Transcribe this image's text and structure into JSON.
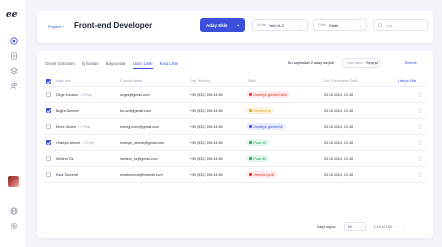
{
  "sidebar": {
    "logo": "ee",
    "icons": [
      "target-icon",
      "document-icon",
      "layers-icon",
      "users-icon"
    ],
    "bottom_icons": [
      "globe-icon",
      "settings-icon"
    ]
  },
  "header": {
    "breadcrumb": "Projeler /",
    "title": "Front-end Developer",
    "add_button": "Aday Ekle",
    "sort": {
      "label": "Sırala",
      "value": "İsim A-Z"
    },
    "filter": {
      "label": "Filtre",
      "value": "Statü"
    },
    "search_placeholder": "Ara"
  },
  "tabs": [
    {
      "label": "Genel Görünüm",
      "state": "default"
    },
    {
      "label": "İş İlanları",
      "state": "default"
    },
    {
      "label": "Başvurular",
      "state": "default"
    },
    {
      "label": "Uzun Liste",
      "state": "active"
    },
    {
      "label": "Kısa Liste",
      "state": "blue"
    }
  ],
  "per_page": {
    "label": "Bu sayfadaki 2 aday seçildi",
    "select_label": "Toplu işlem",
    "select_value": "Seçiniz",
    "clear_link": "Temizle"
  },
  "table": {
    "headers": {
      "name": "Aday İsmi",
      "email": "E-posta Adresi",
      "phone": "Cep Telefonu",
      "status": "Statü",
      "date": "Son Güncelleme Tarihi",
      "action": "Listeye Ekle"
    },
    "rows": [
      {
        "checked": false,
        "name": "Özge Kocaca",
        "proj": "• 2 Proje",
        "email": "ozgek@gmail.com",
        "phone": "+90 (532) 255 44 66",
        "status": "Davetiye gönderilmedi",
        "status_color": "#e0342b",
        "status_bg": "#fdeceb",
        "date": "03.10.2023, 21:45"
      },
      {
        "checked": true,
        "name": "Buğra Demirel",
        "proj": "",
        "email": "bu.ozd@gmail.com",
        "phone": "+90 (532) 255 44 66",
        "status": "İncelemiyor",
        "status_color": "#e0a423",
        "status_bg": "#fdf4e1",
        "date": "03.10.2023, 21:45"
      },
      {
        "checked": false,
        "name": "Emre Güven",
        "proj": "• 2 Proje",
        "email": "emreg.uven@gmail.com",
        "phone": "+90 (532) 255 44 66",
        "status": "Davetiye gönderildi",
        "status_color": "#3b4fd8",
        "status_bg": "#e9ecfd",
        "date": "03.10.2023, 21:45"
      },
      {
        "checked": true,
        "name": "Hüseyin Ahmet",
        "proj": "• 4 Proje",
        "email": "huseyin_ahmet@gmail.com",
        "phone": "+90 (532) 255 44 66",
        "status": "Puan 25",
        "status_color": "#22a95a",
        "status_bg": "#e5f6ec",
        "date": "03.10.2023, 21:45"
      },
      {
        "checked": false,
        "name": "Meltem Öz",
        "proj": "",
        "email": "meltem_oz@gmail.com",
        "phone": "+90 (532) 255 44 66",
        "status": "Puan 80",
        "status_color": "#22a95a",
        "status_bg": "#e5f6ec",
        "date": "03.10.2023, 21:45"
      },
      {
        "checked": false,
        "name": "Esra Tosverdi",
        "proj": "",
        "email": "esratosverdi@hotmail.com",
        "phone": "+90 (532) 255 44 66",
        "status": "Yetersiz içerik",
        "status_color": "#e0342b",
        "status_bg": "#fdeceb",
        "date": "03.10.2023, 21:45"
      }
    ]
  },
  "footer": {
    "rows_label": "Kayıt sayısı",
    "rows_value": "10",
    "range": "1-10 of 100",
    "prev": "‹",
    "next": "›"
  },
  "colors": {
    "accent": "#3b4fd8",
    "background": "#f4f5f9"
  }
}
